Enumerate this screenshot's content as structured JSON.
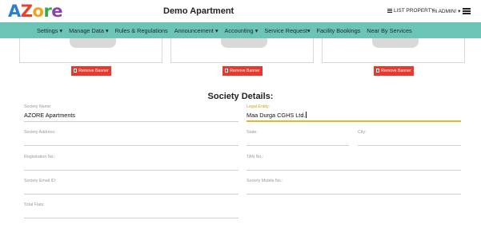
{
  "brand": {
    "logo_letters": [
      "A",
      "Z",
      "o",
      "r",
      "e"
    ]
  },
  "header": {
    "title": "Demo Apartment",
    "list_property": "LIST PROPERTY",
    "admin": "Hi ADMIN!",
    "menu_icon": "hamburger-icon"
  },
  "nav": {
    "items": [
      "Settings",
      "Manage Data",
      "Rules & Regulations",
      "Announcement",
      "Accounting",
      "Service Request",
      "Facility Bookings",
      "Near By Services"
    ],
    "dropdown_marker": "▾"
  },
  "banners": {
    "remove_label": "Remove Banner",
    "count": 3
  },
  "section": {
    "title": "Society Details:"
  },
  "form": {
    "society_name": {
      "label": "Society Name:",
      "value": "AZORE Apartments"
    },
    "legal_entity": {
      "label": "Legal Entity:",
      "value": "Maa Durga CGHS Ltd."
    },
    "society_address": {
      "label": "Society Address:",
      "value": ""
    },
    "state": {
      "label": "State:",
      "value": ""
    },
    "city": {
      "label": "City:",
      "value": ""
    },
    "registration_no": {
      "label": "Registration No.:",
      "value": ""
    },
    "tan_no": {
      "label": "TAN No.:",
      "value": ""
    },
    "society_email": {
      "label": "Society Email ID:",
      "value": ""
    },
    "society_mobile": {
      "label": "Society Mobile No.:",
      "value": ""
    },
    "total_flats": {
      "label": "Total Flats:",
      "value": ""
    }
  },
  "colors": {
    "nav_bg": "#6cc4b7",
    "remove_btn": "#e8392e",
    "active_underline": "#e0b92c"
  }
}
